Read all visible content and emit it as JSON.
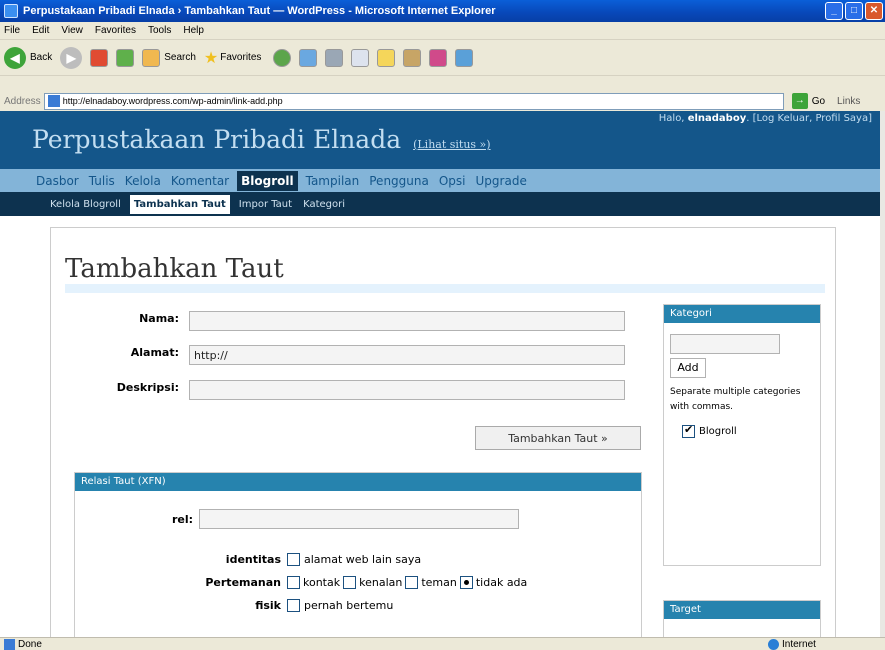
{
  "window": {
    "title": "Perpustakaan Pribadi Elnada › Tambahkan Taut — WordPress - Microsoft Internet Explorer"
  },
  "menu": [
    "File",
    "Edit",
    "View",
    "Favorites",
    "Tools",
    "Help"
  ],
  "toolbar": {
    "back_label": "Back",
    "search_label": "Search",
    "favorites_label": "Favorites"
  },
  "address": {
    "label": "Address",
    "url": "http://elnadaboy.wordpress.com/wp-admin/link-add.php",
    "go_label": "Go",
    "links_label": "Links"
  },
  "wp": {
    "site_title": "Perpustakaan Pribadi Elnada",
    "view_site": "(Lihat situs »)",
    "user_greeting": "Halo,",
    "user_name": "elnadaboy",
    "user_links": ". [Log Keluar, Profil Saya]",
    "nav": [
      "Dasbor",
      "Tulis",
      "Kelola",
      "Komentar",
      "Blogroll",
      "Tampilan",
      "Pengguna",
      "Opsi",
      "Upgrade"
    ],
    "nav_active": "Blogroll",
    "subnav": [
      "Kelola Blogroll",
      "Tambahkan Taut",
      "Impor Taut",
      "Kategori"
    ],
    "subnav_active": "Tambahkan Taut",
    "page_heading": "Tambahkan Taut",
    "form": {
      "name_label": "Nama:",
      "name_value": "",
      "url_label": "Alamat:",
      "url_value": "http://",
      "desc_label": "Deskripsi:",
      "desc_value": "",
      "submit_label": "Tambahkan Taut »"
    },
    "category_box": {
      "title": "Kategori",
      "add_label": "Add",
      "hint": "Separate multiple categories with commas.",
      "items": [
        {
          "label": "Blogroll",
          "checked": true
        }
      ]
    },
    "target_box": {
      "title": "Target"
    },
    "xfn": {
      "title": "Relasi Taut (XFN)",
      "rel_label": "rel:",
      "rel_value": "",
      "identity_label": "identitas",
      "identity_option": "alamat web lain saya",
      "friendship_label": "Pertemanan",
      "friendship_options": [
        "kontak",
        "kenalan",
        "teman",
        "tidak ada"
      ],
      "friendship_selected": "tidak ada",
      "physical_label": "fisik",
      "physical_option": "pernah bertemu"
    }
  },
  "status": {
    "text": "Done",
    "zone": "Internet"
  }
}
